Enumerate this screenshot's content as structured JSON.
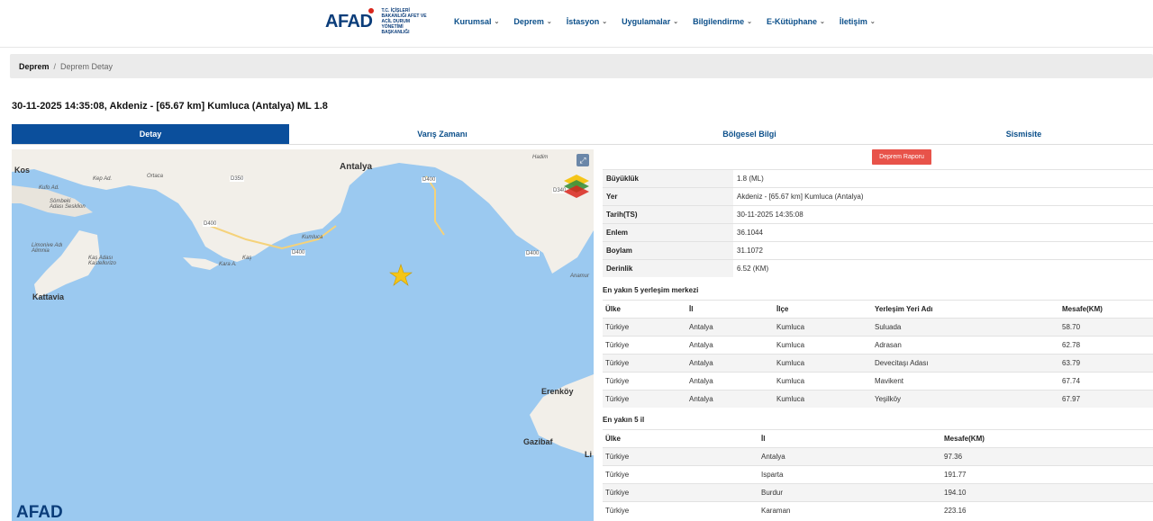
{
  "header": {
    "logo_text": "AFAD",
    "logo_sub": "T.C. İÇİŞLERİ BAKANLIĞI AFET VE ACİL DURUM YÖNETİMİ BAŞKANLIĞI",
    "nav": [
      "Kurumsal",
      "Deprem",
      "İstasyon",
      "Uygulamalar",
      "Bilgilendirme",
      "E-Kütüphane",
      "İletişim"
    ]
  },
  "breadcrumb": {
    "root": "Deprem",
    "separator": "/",
    "current": "Deprem Detay"
  },
  "title": "30-11-2025 14:35:08, Akdeniz - [65.67 km] Kumluca (Antalya) ML 1.8",
  "tabs": [
    "Detay",
    "Varış Zamanı",
    "Bölgesel Bilgi",
    "Sismisite"
  ],
  "map": {
    "labels": [
      "Kos",
      "Antalya",
      "Kattavia",
      "Erenköy",
      "Gazibaf",
      "Kumluca",
      "Kaş",
      "Hadim",
      "Ortaca",
      "Sömbeki Adası Sesklion",
      "Limonive Adı Alimnia",
      "Kaş Adası Kastellorizo",
      "Kara A.",
      "Anamur",
      "Li",
      "Kep Ad.",
      "Kufo Ad.",
      "D350",
      "D400",
      "D400",
      "D400",
      "D340",
      "D400"
    ],
    "logo": "AFAD",
    "colors": {
      "sea": "#9bc9f0",
      "land": "#f2efe9",
      "star": "#f5c518"
    }
  },
  "report_button": "Deprem Raporu",
  "info": [
    {
      "key": "Büyüklük",
      "value": "1.8 (ML)"
    },
    {
      "key": "Yer",
      "value": "Akdeniz - [65.67 km] Kumluca (Antalya)"
    },
    {
      "key": "Tarih(TS)",
      "value": "30-11-2025 14:35:08"
    },
    {
      "key": "Enlem",
      "value": "36.1044"
    },
    {
      "key": "Boylam",
      "value": "31.1072"
    },
    {
      "key": "Derinlik",
      "value": "6.52 (KM)"
    }
  ],
  "nearest5": {
    "title": "En yakın 5 yerleşim merkezi",
    "headers": [
      "Ülke",
      "İl",
      "İlçe",
      "Yerleşim Yeri Adı",
      "Mesafe(KM)"
    ],
    "rows": [
      [
        "Türkiye",
        "Antalya",
        "Kumluca",
        "Suluada",
        "58.70"
      ],
      [
        "Türkiye",
        "Antalya",
        "Kumluca",
        "Adrasan",
        "62.78"
      ],
      [
        "Türkiye",
        "Antalya",
        "Kumluca",
        "Devecitaşı Adası",
        "63.79"
      ],
      [
        "Türkiye",
        "Antalya",
        "Kumluca",
        "Mavikent",
        "67.74"
      ],
      [
        "Türkiye",
        "Antalya",
        "Kumluca",
        "Yeşilköy",
        "67.97"
      ]
    ]
  },
  "nearest_il": {
    "title": "En yakın 5 il",
    "headers": [
      "Ülke",
      "İl",
      "Mesafe(KM)"
    ],
    "rows": [
      [
        "Türkiye",
        "Antalya",
        "97.36"
      ],
      [
        "Türkiye",
        "Isparta",
        "191.77"
      ],
      [
        "Türkiye",
        "Burdur",
        "194.10"
      ],
      [
        "Türkiye",
        "Karaman",
        "223.16"
      ]
    ]
  }
}
